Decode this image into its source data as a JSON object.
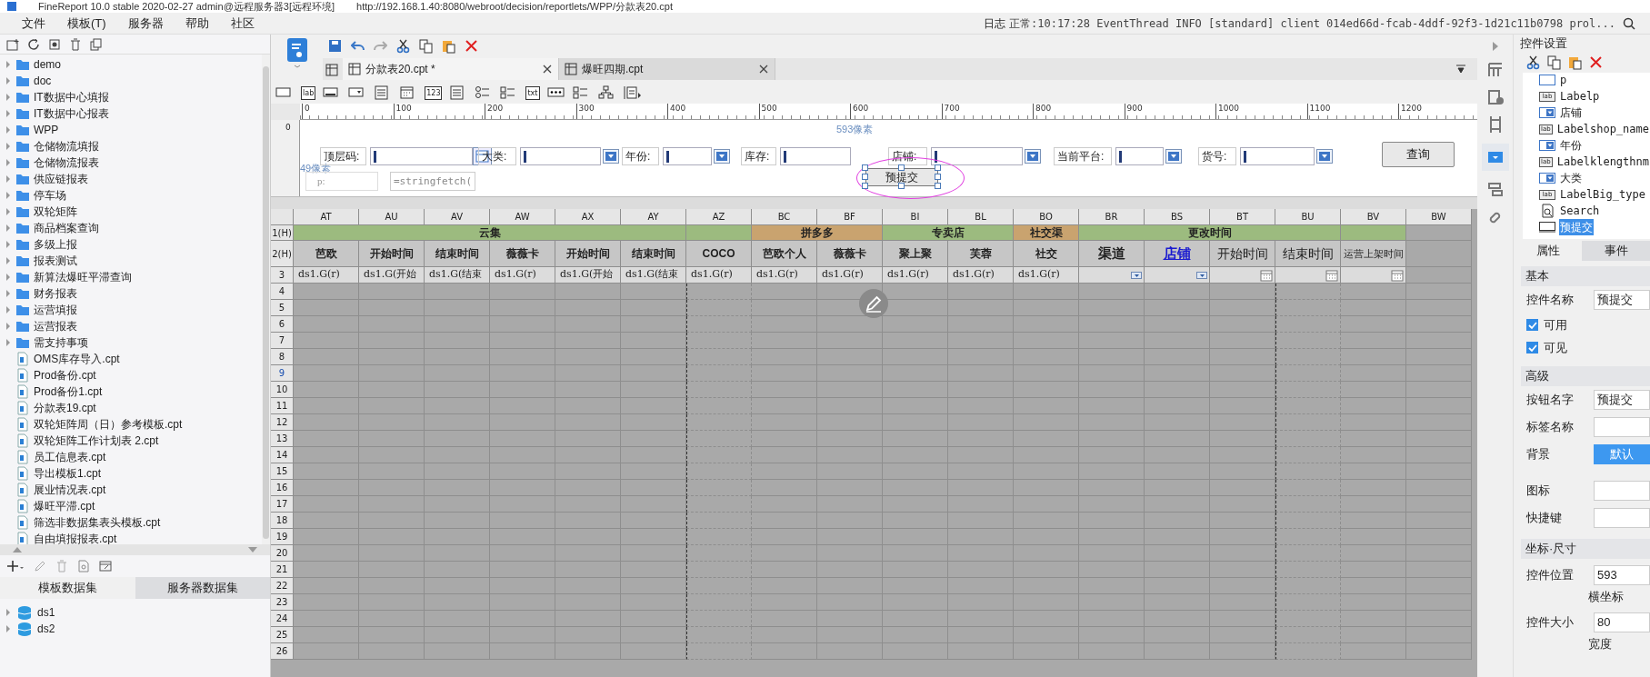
{
  "title_bar": {
    "app": "FineReport 10.0 stable 2020-02-27 admin@远程服务器3[远程环境]",
    "url": "http://192.168.1.40:8080/webroot/decision/reportlets/WPP/分款表20.cpt"
  },
  "menu": [
    "文件",
    "模板(T)",
    "服务器",
    "帮助",
    "社区"
  ],
  "log": {
    "label": "日志",
    "message": "正常:10:17:28 EventThread INFO [standard] client 014ed66d-fcab-4ddf-92f3-1d21c11b0798 prol..."
  },
  "file_tree": [
    {
      "name": "demo",
      "kind": "folder"
    },
    {
      "name": "doc",
      "kind": "folder"
    },
    {
      "name": "IT数据中心填报",
      "kind": "folder"
    },
    {
      "name": "IT数据中心报表",
      "kind": "folder"
    },
    {
      "name": "WPP",
      "kind": "folder"
    },
    {
      "name": "仓储物流填报",
      "kind": "folder"
    },
    {
      "name": "仓储物流报表",
      "kind": "folder"
    },
    {
      "name": "供应链报表",
      "kind": "folder"
    },
    {
      "name": "停车场",
      "kind": "folder"
    },
    {
      "name": "双轮矩阵",
      "kind": "folder"
    },
    {
      "name": "商品档案查询",
      "kind": "folder"
    },
    {
      "name": "多级上报",
      "kind": "folder"
    },
    {
      "name": "报表测试",
      "kind": "folder"
    },
    {
      "name": "新算法爆旺平滞查询",
      "kind": "folder"
    },
    {
      "name": "财务报表",
      "kind": "folder"
    },
    {
      "name": "运营填报",
      "kind": "folder"
    },
    {
      "name": "运营报表",
      "kind": "folder"
    },
    {
      "name": "需支持事项",
      "kind": "folder"
    },
    {
      "name": "OMS库存导入.cpt",
      "kind": "file"
    },
    {
      "name": "Prod备份.cpt",
      "kind": "file"
    },
    {
      "name": "Prod备份1.cpt",
      "kind": "file"
    },
    {
      "name": "分款表19.cpt",
      "kind": "file"
    },
    {
      "name": "双轮矩阵周（日）参考模板.cpt",
      "kind": "file"
    },
    {
      "name": "双轮矩阵工作计划表 2.cpt",
      "kind": "file"
    },
    {
      "name": "员工信息表.cpt",
      "kind": "file"
    },
    {
      "name": "导出模板1.cpt",
      "kind": "file"
    },
    {
      "name": "展业情况表.cpt",
      "kind": "file"
    },
    {
      "name": "爆旺平滞.cpt",
      "kind": "file"
    },
    {
      "name": "筛选非数据集表头模板.cpt",
      "kind": "file"
    },
    {
      "name": "自由填报报表.cpt",
      "kind": "file"
    }
  ],
  "dataset_tabs": [
    {
      "label": "模板数据集",
      "selected": true
    },
    {
      "label": "服务器数据集",
      "selected": false
    }
  ],
  "datasets": [
    "ds1",
    "ds2"
  ],
  "editor_tabs": [
    {
      "label": "分款表20.cpt *",
      "selected": true
    },
    {
      "label": "爆旺四期.cpt",
      "selected": false
    }
  ],
  "widget_toolbar": [
    {
      "kind": "textbox"
    },
    {
      "kind": "glyph",
      "text": "lab"
    },
    {
      "kind": "button"
    },
    {
      "kind": "combo"
    },
    {
      "kind": "list"
    },
    {
      "kind": "calendar"
    },
    {
      "kind": "glyph",
      "text": "123"
    },
    {
      "kind": "list"
    },
    {
      "kind": "radio"
    },
    {
      "kind": "checkbox"
    },
    {
      "kind": "glyph",
      "text": "txt"
    },
    {
      "kind": "password"
    },
    {
      "kind": "checkbox"
    },
    {
      "kind": "tree"
    },
    {
      "kind": "more"
    }
  ],
  "ruler": [
    "0",
    "100",
    "200",
    "300",
    "400",
    "500",
    "600",
    "700",
    "800",
    "900",
    "1000",
    "1100",
    "1200"
  ],
  "ruler_vertical": "0",
  "parameter_pane": {
    "width_hint": "593像素",
    "height_hint": "49像素",
    "params": [
      {
        "label": "顶层码:",
        "kind": "tree"
      },
      {
        "label": "大类:",
        "kind": "combo"
      },
      {
        "label": "年份:",
        "kind": "combo"
      },
      {
        "label": "库存:",
        "kind": "text"
      },
      {
        "label": "店铺:",
        "kind": "combo"
      },
      {
        "label": "当前平台:",
        "kind": "combo"
      },
      {
        "label": "货号:",
        "kind": "combo"
      }
    ],
    "query_button": "查询",
    "hidden_label": "p:",
    "formula_field": "=stringfetch(",
    "submit_button": {
      "label": "预提交",
      "selected": true
    }
  },
  "grid": {
    "columns": [
      "AT",
      "AU",
      "AV",
      "AW",
      "AX",
      "AY",
      "AZ",
      "BC",
      "BF",
      "BI",
      "BL",
      "BO",
      "BR",
      "BS",
      "BT",
      "BU",
      "BV",
      "BW"
    ],
    "group_row": {
      "label": "1(H)",
      "cells": [
        {
          "text": "云集",
          "color": "#9cbb7f"
        },
        {
          "color": "#9cbb7f"
        },
        {
          "text": "拼多多",
          "color": "#c9a36f"
        },
        {
          "text": "专卖店",
          "color": "#9cbb7f"
        },
        {
          "text": "社交渠",
          "color": "#c9a36f"
        },
        {
          "text": "更改时间",
          "color": "#9cbb7f"
        },
        {
          "color": "#9cbb7f"
        }
      ]
    },
    "header_row": {
      "label": "2(H)",
      "cells": [
        {
          "text": "芭欧",
          "kind": "plain"
        },
        {
          "text": "开始时间",
          "kind": "plain"
        },
        {
          "text": "结束时间",
          "kind": "plain"
        },
        {
          "text": "薇薇卡",
          "kind": "plain"
        },
        {
          "text": "开始时间",
          "kind": "plain"
        },
        {
          "text": "结束时间",
          "kind": "plain"
        },
        {
          "text": "COCO",
          "kind": "plain"
        },
        {
          "text": "芭欧个人",
          "kind": "plain"
        },
        {
          "text": "薇薇卡",
          "kind": "plain"
        },
        {
          "text": "聚上聚",
          "kind": "plain"
        },
        {
          "text": "芙蓉",
          "kind": "plain"
        },
        {
          "text": "社交",
          "kind": "plain"
        },
        {
          "text": "渠道",
          "kind": "strong"
        },
        {
          "text": "店铺",
          "kind": "link"
        },
        {
          "text": "开始时间",
          "kind": "large"
        },
        {
          "text": "结束时间",
          "kind": "large"
        },
        {
          "text": "运营上架时间",
          "kind": "small"
        }
      ]
    },
    "data_row": {
      "label": "3",
      "cells": [
        {
          "kind": "formula",
          "text": "ds1.G(r)"
        },
        {
          "kind": "formula",
          "text": "ds1.G(开始"
        },
        {
          "kind": "formula",
          "text": "ds1.G(结束"
        },
        {
          "kind": "formula",
          "text": "ds1.G(r)"
        },
        {
          "kind": "formula",
          "text": "ds1.G(开始"
        },
        {
          "kind": "formula",
          "text": "ds1.G(结束"
        },
        {
          "kind": "formula",
          "text": "ds1.G(r)"
        },
        {
          "kind": "formula",
          "text": "ds1.G(r)"
        },
        {
          "kind": "formula",
          "text": "ds1.G(r)"
        },
        {
          "kind": "formula",
          "text": "ds1.G(r)"
        },
        {
          "kind": "formula",
          "text": "ds1.G(r)"
        },
        {
          "kind": "formula",
          "text": "ds1.G(r)"
        },
        {
          "kind": "dropdown"
        },
        {
          "kind": "dropdown"
        },
        {
          "kind": "date"
        },
        {
          "kind": "date"
        },
        {
          "kind": "date"
        }
      ]
    },
    "rows": [
      {
        "label": "4",
        "selected": false
      },
      {
        "label": "5",
        "selected": false
      },
      {
        "label": "6",
        "selected": false
      },
      {
        "label": "7",
        "selected": false
      },
      {
        "label": "8",
        "selected": false
      },
      {
        "label": "9",
        "selected": true
      },
      {
        "label": "10",
        "selected": false
      },
      {
        "label": "11",
        "selected": false
      },
      {
        "label": "12",
        "selected": false
      },
      {
        "label": "13",
        "selected": false
      },
      {
        "label": "14",
        "selected": false
      },
      {
        "label": "15",
        "selected": false
      },
      {
        "label": "16",
        "selected": false
      },
      {
        "label": "17",
        "selected": false
      },
      {
        "label": "18",
        "selected": false
      },
      {
        "label": "19",
        "selected": false
      },
      {
        "label": "20",
        "selected": false
      },
      {
        "label": "21",
        "selected": false
      },
      {
        "label": "22",
        "selected": false
      },
      {
        "label": "23",
        "selected": false
      },
      {
        "label": "24",
        "selected": false
      },
      {
        "label": "25",
        "selected": false
      },
      {
        "label": "26",
        "selected": false
      }
    ]
  },
  "settings": {
    "title": "控件设置",
    "widget_tree": [
      {
        "name": "p",
        "kind": "box",
        "selected": false
      },
      {
        "name": "Labelp",
        "kind": "label",
        "icon_text": "lab",
        "selected": false
      },
      {
        "name": "店铺",
        "kind": "combo",
        "selected": false
      },
      {
        "name": "Labelshop_name",
        "kind": "label",
        "icon_text": "lab",
        "selected": false
      },
      {
        "name": "年份",
        "kind": "combo",
        "selected": false
      },
      {
        "name": "Labelklengthnm",
        "kind": "label",
        "icon_text": "lab",
        "selected": false
      },
      {
        "name": "大类",
        "kind": "combo",
        "selected": false
      },
      {
        "name": "LabelBig_type",
        "kind": "label",
        "icon_text": "lab",
        "selected": false
      },
      {
        "name": "Search",
        "kind": "search",
        "selected": false
      },
      {
        "name": "预提交",
        "kind": "button",
        "selected": true
      }
    ],
    "tabs": [
      {
        "label": "属性",
        "selected": true
      },
      {
        "label": "事件",
        "selected": false
      }
    ],
    "sections": [
      {
        "title": "基本",
        "rows": [
          {
            "kind": "field",
            "label": "控件名称",
            "value": "预提交"
          },
          {
            "kind": "check",
            "label": "可用",
            "checked": true
          },
          {
            "kind": "check",
            "label": "可见",
            "checked": true
          }
        ]
      },
      {
        "title": "高级",
        "rows": [
          {
            "kind": "field",
            "label": "按钮名字",
            "value": "预提交"
          },
          {
            "kind": "field",
            "label": "标签名称"
          },
          {
            "kind": "button",
            "label": "背景",
            "value": "默认"
          },
          {
            "kind": "field",
            "label": "图标"
          },
          {
            "kind": "field",
            "label": "快捷键"
          }
        ]
      },
      {
        "title": "坐标·尺寸",
        "rows": [
          {
            "kind": "number",
            "label": "控件位置",
            "value": "593",
            "caption": "横坐标"
          },
          {
            "kind": "number",
            "label": "控件大小",
            "value": "80",
            "caption": "宽度"
          }
        ]
      }
    ]
  }
}
